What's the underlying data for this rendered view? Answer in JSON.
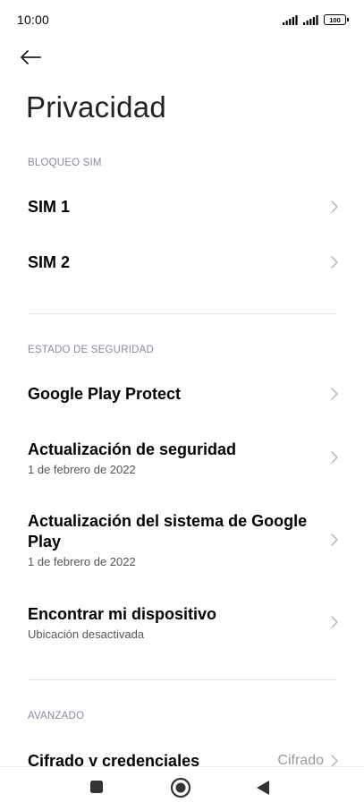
{
  "status_bar": {
    "time": "10:00",
    "battery_level": "100",
    "icons": [
      "signal-sim1-icon",
      "signal-sim2-icon",
      "battery-icon"
    ]
  },
  "header": {
    "back_icon": "arrow-left-icon",
    "title": "Privacidad"
  },
  "sections": [
    {
      "header": "BLOQUEO SIM",
      "items": [
        {
          "title": "SIM 1"
        },
        {
          "title": "SIM 2"
        }
      ]
    },
    {
      "header": "ESTADO DE SEGURIDAD",
      "items": [
        {
          "title": "Google Play Protect"
        },
        {
          "title": "Actualización de seguridad",
          "subtitle": "1 de febrero de 2022"
        },
        {
          "title": "Actualización del sistema de Google Play",
          "subtitle": "1 de febrero de 2022"
        },
        {
          "title": "Encontrar mi dispositivo",
          "subtitle": "Ubicación desactivada"
        }
      ]
    },
    {
      "header": "AVANZADO",
      "items": [
        {
          "title": "Cifrado y credenciales",
          "value": "Cifrado"
        }
      ]
    }
  ],
  "nav_bar": {
    "icons": [
      "recents-square-icon",
      "home-circle-icon",
      "back-triangle-icon"
    ]
  },
  "colors": {
    "background": "#ffffff",
    "section_header": "#8a8a99",
    "divider": "#e6e6e6",
    "chevron": "#b5b5b5",
    "nav_icon": "#333333"
  }
}
